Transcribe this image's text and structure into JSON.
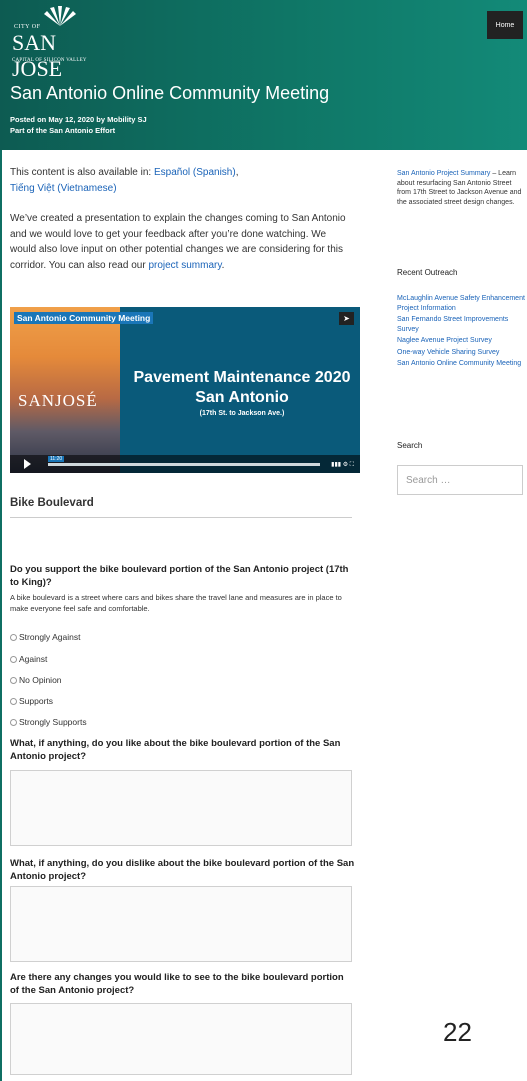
{
  "header": {
    "logo": {
      "city": "CITY OF",
      "name": "SAN JOSE",
      "tagline": "CAPITAL OF SILICON VALLEY"
    },
    "nav_home": "Home",
    "title": "San Antonio Online Community Meeting",
    "posted": "Posted on May 12, 2020 by Mobility SJ",
    "part_of": "Part of the San Antonio Effort"
  },
  "main": {
    "lang_prefix": "This content is also available in: ",
    "lang_spanish": "Español (Spanish)",
    "lang_sep": ",",
    "lang_vietnamese": "Tiếng Việt (Vietnamese)",
    "intro_text": "We’ve created a presentation to explain the changes coming to San Antonio and we would love to get your feedback after you’re done watching. We would also love input on other potential changes we are considering for this corridor. You can also read our ",
    "intro_link": "project summary",
    "intro_end": ".",
    "video": {
      "label": "San Antonio Community Meeting",
      "logo_text": "SANJOSÉ",
      "line1": "Pavement Maintenance 2020",
      "line2": "San Antonio",
      "line3": "(17th St. to Jackson Ave.)",
      "time": "11:20"
    },
    "section_title": "Bike Boulevard",
    "q1": "Do you support the bike boulevard portion of the San Antonio project (17th to King)?",
    "q1_desc": "A bike boulevard is a street where cars and bikes share the travel lane and measures are in place to make everyone feel safe and comfortable.",
    "options": [
      "Strongly Against",
      "Against",
      "No Opinion",
      "Supports",
      "Strongly Supports"
    ],
    "q2": "What, if anything, do you like about the bike boulevard portion of the San Antonio project?",
    "q3": "What, if anything, do you dislike about the bike boulevard portion of the San Antonio project?",
    "q4": "Are there any changes you would like to see to the bike boulevard portion of the San Antonio project?"
  },
  "sidebar": {
    "summary_link": "San Antonio Project Summary",
    "summary_text": " – Learn about resurfacing San Antonio Street from 17th Street to Jackson Avenue and the associated street design changes.",
    "recent_heading": "Recent Outreach",
    "recent": [
      "McLaughlin Avenue Safety Enhancement Project Information",
      "San Fernando Street Improvements Survey",
      "Naglee Avenue Project Survey",
      "One-way Vehicle Sharing Survey",
      "San Antonio Online Community Meeting"
    ],
    "search_heading": "Search",
    "search_placeholder": "Search …"
  },
  "page_number": "22",
  "colors": {
    "header": "#0f7666",
    "link": "#1a63b8",
    "video_bg": "#0a5a7a"
  }
}
